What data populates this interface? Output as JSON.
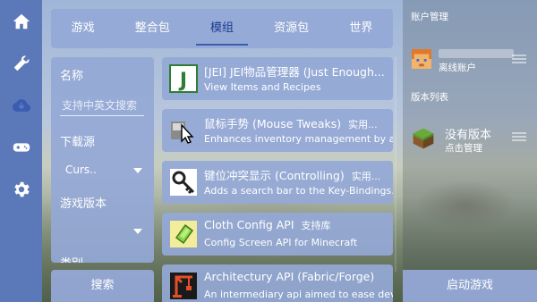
{
  "nav_rail": {
    "items": [
      {
        "icon": "home-icon"
      },
      {
        "icon": "wrench-icon"
      },
      {
        "icon": "cloud-download-icon"
      },
      {
        "icon": "gamepad-icon"
      },
      {
        "icon": "gear-icon"
      }
    ],
    "active_color": "#3a5db2"
  },
  "tabs": [
    {
      "label": "游戏",
      "active": false
    },
    {
      "label": "整合包",
      "active": false
    },
    {
      "label": "模组",
      "active": true
    },
    {
      "label": "资源包",
      "active": false
    },
    {
      "label": "世界",
      "active": false
    }
  ],
  "filters": {
    "name_label": "名称",
    "search_placeholder": "支持中英文搜索",
    "source_label": "下载源",
    "source_value": "Curs..",
    "version_label": "游戏版本",
    "version_value": "",
    "category_label": "类别",
    "search_button": "搜索"
  },
  "mods": [
    {
      "title": "[JEI] JEI物品管理器 (Just Enough...",
      "tag": "",
      "desc": "View Items and Recipes",
      "icon": "jei-icon"
    },
    {
      "title": "鼠标手势 (Mouse Tweaks)",
      "tag": "实用...",
      "desc": "Enhances inventory management by a...",
      "icon": "mouse-cursor-icon"
    },
    {
      "title": "键位冲突显示 (Controlling)",
      "tag": "实用...",
      "desc": "Adds a search bar to the Key-Bindings...",
      "icon": "key-icon"
    },
    {
      "title": "Cloth Config API",
      "tag": "支持库",
      "desc": "Config Screen API for Minecraft",
      "icon": "cloth-icon"
    },
    {
      "title": "Architectury API (Fabric/Forge)",
      "tag": "",
      "desc": "An intermediary api aimed to ease dev...",
      "icon": "crane-icon"
    }
  ],
  "sidebar_right": {
    "account_header": "账户管理",
    "account_type": "离线账户",
    "version_header": "版本列表",
    "version_title": "没有版本",
    "version_sub": "点击管理",
    "launch_button": "启动游戏"
  },
  "colors": {
    "rail": "#5b79b8",
    "panel": "#94a8d6",
    "active_tab": "#1b3d8f"
  }
}
